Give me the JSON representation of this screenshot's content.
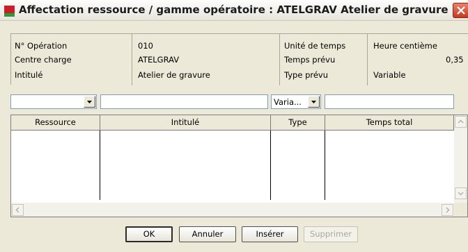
{
  "window": {
    "title": "Affectation ressource / gamme opératoire : ATELGRAV Atelier de gravure"
  },
  "info": {
    "left": [
      {
        "label": "N° Opération",
        "value": "010"
      },
      {
        "label": "Centre charge",
        "value": "ATELGRAV"
      },
      {
        "label": "Intitulé",
        "value": "Atelier de gravure"
      }
    ],
    "right": [
      {
        "label": "Unité de temps",
        "value": "Heure centième"
      },
      {
        "label": "Temps prévu",
        "value": "0,35"
      },
      {
        "label": "Type prévu",
        "value": "Variable"
      }
    ]
  },
  "filters": {
    "resource_value": "",
    "intitule_value": "",
    "type_value": "Varia...",
    "temps_value": ""
  },
  "grid": {
    "columns": [
      "Ressource",
      "Intitulé",
      "Type",
      "Temps total"
    ],
    "rows": []
  },
  "buttons": {
    "ok": "OK",
    "cancel": "Annuler",
    "insert": "Insérer",
    "delete": "Supprimer"
  },
  "colors": {
    "window_bg": "#ece9d8",
    "icon_red": "#c8202a",
    "icon_green": "#2d9a3a",
    "close_red": "#c33b22"
  }
}
